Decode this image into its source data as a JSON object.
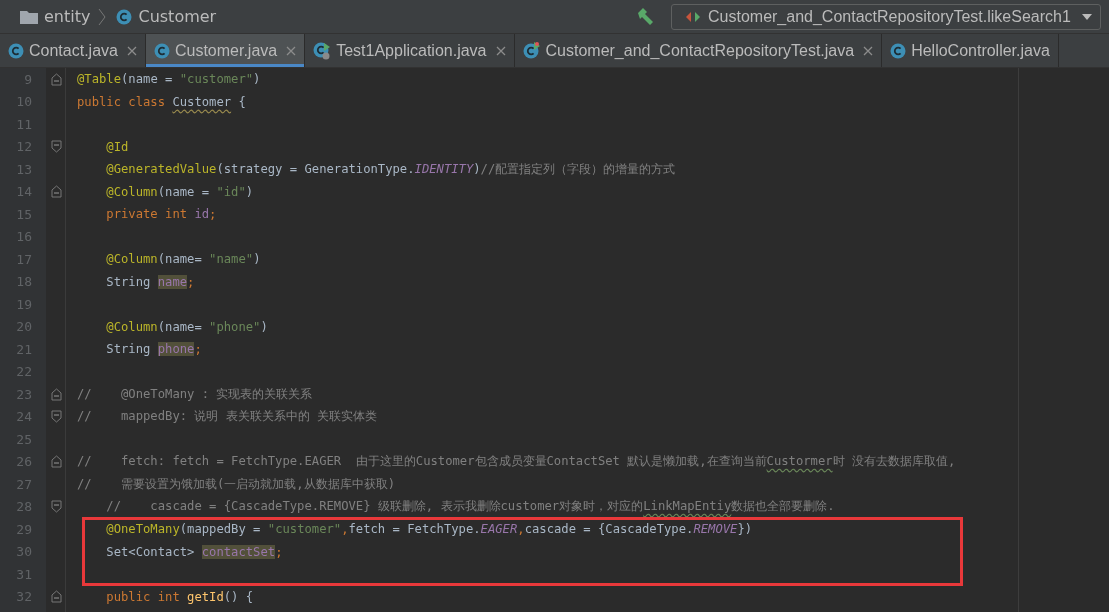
{
  "breadcrumbs": [
    {
      "kind": "folder",
      "label": "entity"
    },
    {
      "kind": "class",
      "label": "Customer"
    }
  ],
  "run_config": {
    "label": "Customer_and_ContactRepositoryTest.likeSearch1"
  },
  "tabs": [
    {
      "label": "Contact.java",
      "kind": "class",
      "selected": false,
      "closable": true
    },
    {
      "label": "Customer.java",
      "kind": "class",
      "selected": true,
      "closable": true
    },
    {
      "label": "Test1Application.java",
      "kind": "app",
      "selected": false,
      "closable": true
    },
    {
      "label": "Customer_and_ContactRepositoryTest.java",
      "kind": "test",
      "selected": false,
      "closable": true
    },
    {
      "label": "HelloController.java",
      "kind": "class",
      "selected": false,
      "closable": false
    }
  ],
  "lines": [
    {
      "number": "9",
      "kind": "foldstart",
      "framed": false,
      "tokens": [
        {
          "kind": "ann",
          "text": "@Table"
        },
        {
          "kind": "plain",
          "text": "(name = "
        },
        {
          "kind": "str",
          "text": "\"customer\""
        },
        {
          "kind": "plain",
          "text": ")"
        }
      ]
    },
    {
      "number": "10",
      "kind": "plain",
      "framed": false,
      "tokens": [
        {
          "kind": "kw",
          "text": "public class "
        },
        {
          "kind": "warn",
          "text": "Customer"
        },
        {
          "kind": "plain",
          "text": " {"
        }
      ]
    },
    {
      "number": "11",
      "kind": "plain",
      "framed": false
    },
    {
      "number": "12",
      "kind": "foldend",
      "framed": false,
      "tokens": [
        {
          "kind": "ann",
          "text": "    @Id"
        }
      ]
    },
    {
      "number": "13",
      "kind": "plain",
      "framed": false,
      "tokens": [
        {
          "kind": "ann",
          "text": "    @GeneratedValue"
        },
        {
          "kind": "plain",
          "text": "(strategy = GenerationType."
        },
        {
          "kind": "const",
          "text": "IDENTITY"
        },
        {
          "kind": "plain",
          "text": ")"
        },
        {
          "kind": "comment",
          "text": "//配置指定列（字段）的增量的方式"
        }
      ]
    },
    {
      "number": "14",
      "kind": "foldstart",
      "framed": false,
      "tokens": [
        {
          "kind": "ann",
          "text": "    @Column"
        },
        {
          "kind": "plain",
          "text": "(name = "
        },
        {
          "kind": "str",
          "text": "\"id\""
        },
        {
          "kind": "plain",
          "text": ")"
        }
      ]
    },
    {
      "number": "15",
      "kind": "plain",
      "framed": false,
      "tokens": [
        {
          "kind": "kw",
          "text": "    private int "
        },
        {
          "kind": "field",
          "text": "id"
        },
        {
          "kind": "kw",
          "text": ";"
        }
      ]
    },
    {
      "number": "16",
      "kind": "plain",
      "framed": false
    },
    {
      "number": "17",
      "kind": "plain",
      "framed": false,
      "tokens": [
        {
          "kind": "ann",
          "text": "    @Column"
        },
        {
          "kind": "plain",
          "text": "(name= "
        },
        {
          "kind": "str",
          "text": "\"name\""
        },
        {
          "kind": "plain",
          "text": ")"
        }
      ]
    },
    {
      "number": "18",
      "kind": "plain",
      "framed": false,
      "tokens": [
        {
          "kind": "plain",
          "text": "    String "
        },
        {
          "kind": "field-hl",
          "text": "name"
        },
        {
          "kind": "kw",
          "text": ";"
        }
      ]
    },
    {
      "number": "19",
      "kind": "plain",
      "framed": false
    },
    {
      "number": "20",
      "kind": "plain",
      "framed": false,
      "tokens": [
        {
          "kind": "ann",
          "text": "    @Column"
        },
        {
          "kind": "plain",
          "text": "(name= "
        },
        {
          "kind": "str",
          "text": "\"phone\""
        },
        {
          "kind": "plain",
          "text": ")"
        }
      ]
    },
    {
      "number": "21",
      "kind": "plain",
      "framed": false,
      "tokens": [
        {
          "kind": "plain",
          "text": "    String "
        },
        {
          "kind": "field-hl",
          "text": "phone"
        },
        {
          "kind": "kw",
          "text": ";"
        }
      ]
    },
    {
      "number": "22",
      "kind": "plain",
      "framed": false
    },
    {
      "number": "23",
      "kind": "foldstart",
      "framed": false,
      "tokens": [
        {
          "kind": "comment",
          "text": "//    @OneToMany : 实现表的关联关系"
        }
      ]
    },
    {
      "number": "24",
      "kind": "foldend",
      "framed": false,
      "tokens": [
        {
          "kind": "comment",
          "text": "//    mappedBy: 说明 表关联关系中的 关联实体类"
        }
      ]
    },
    {
      "number": "25",
      "kind": "plain",
      "framed": false
    },
    {
      "number": "26",
      "kind": "foldstart",
      "framed": false,
      "tokens": [
        {
          "kind": "comment",
          "text": "//    fetch: fetch = FetchType.EAGER  由于这里的Customer包含成员变量ContactSet 默认是懒加载,在查询当前"
        },
        {
          "kind": "typo",
          "text": "Custormer"
        },
        {
          "kind": "comment",
          "text": "时 没有去数据库取值,"
        }
      ]
    },
    {
      "number": "27",
      "kind": "plain",
      "framed": false,
      "tokens": [
        {
          "kind": "comment",
          "text": "//    需要设置为饿加载(一启动就加载,从数据库中获取)"
        }
      ]
    },
    {
      "number": "28",
      "kind": "foldend",
      "framed": false,
      "tokens": [
        {
          "kind": "comment",
          "text": "    //    cascade = {CascadeType.REMOVE} 级联删除, 表示我删除customer对象时，对应的"
        },
        {
          "kind": "typo",
          "text": "LinkMapEntiy"
        },
        {
          "kind": "comment",
          "text": "数据也全部要删除."
        }
      ]
    },
    {
      "number": "29",
      "kind": "plain",
      "framed": true,
      "tokens": [
        {
          "kind": "ann",
          "text": "    @OneToMany"
        },
        {
          "kind": "plain",
          "text": "(mappedBy = "
        },
        {
          "kind": "str",
          "text": "\"customer\""
        },
        {
          "kind": "kw",
          "text": ","
        },
        {
          "kind": "plain",
          "text": "fetch = FetchType."
        },
        {
          "kind": "const",
          "text": "EAGER"
        },
        {
          "kind": "kw",
          "text": ","
        },
        {
          "kind": "plain",
          "text": "cascade = {CascadeType."
        },
        {
          "kind": "const",
          "text": "REMOVE"
        },
        {
          "kind": "plain",
          "text": "})"
        }
      ]
    },
    {
      "number": "30",
      "kind": "plain",
      "framed": true,
      "tokens": [
        {
          "kind": "plain",
          "text": "    Set<Contact> "
        },
        {
          "kind": "field-hl",
          "text": "contactSet"
        },
        {
          "kind": "kw",
          "text": ";"
        }
      ]
    },
    {
      "number": "31",
      "kind": "plain",
      "framed": true
    },
    {
      "number": "32",
      "kind": "foldstart",
      "framed": false,
      "tokens": [
        {
          "kind": "kw",
          "text": "    public int "
        },
        {
          "kind": "method",
          "text": "getId"
        },
        {
          "kind": "plain",
          "text": "() {"
        }
      ]
    }
  ]
}
